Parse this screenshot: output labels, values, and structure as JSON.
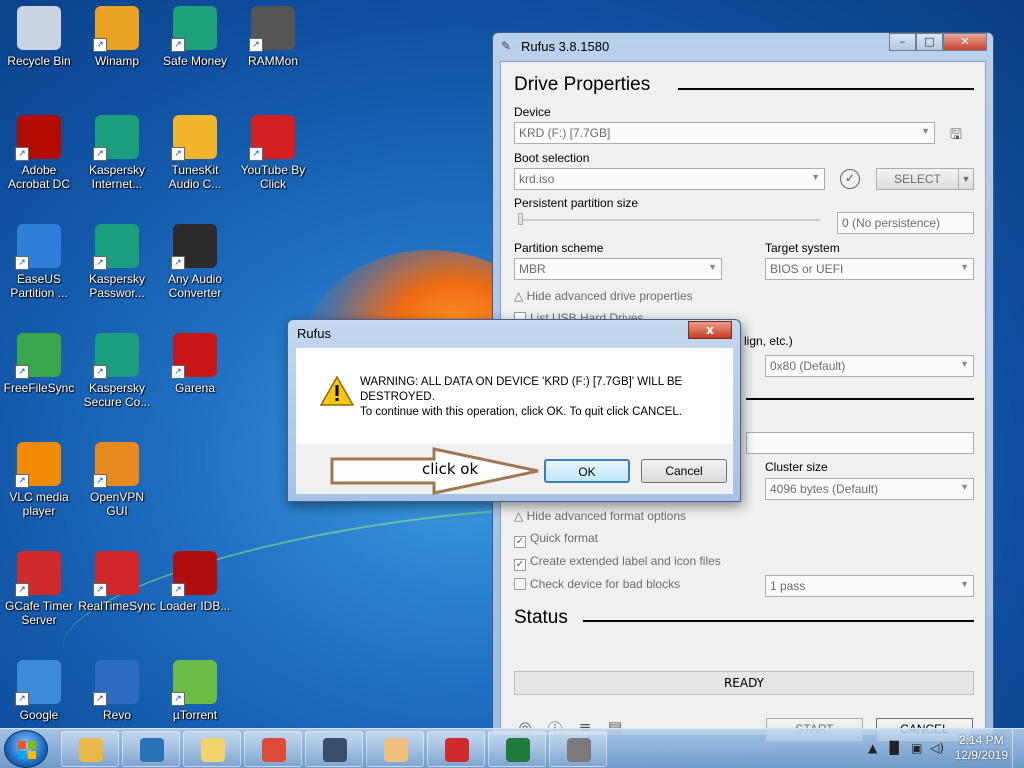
{
  "desktop": {
    "icons": [
      {
        "label": "Recycle Bin",
        "icon": "recycle-bin-icon",
        "color": "#c9d4e0"
      },
      {
        "label": "Winamp",
        "icon": "winamp-icon",
        "color": "#e9a321"
      },
      {
        "label": "Safe Money",
        "icon": "safe-money-icon",
        "color": "#1ba27a"
      },
      {
        "label": "RAMMon",
        "icon": "rammon-icon",
        "color": "#555555"
      },
      {
        "label": "Adobe Acrobat DC",
        "icon": "acrobat-icon",
        "color": "#b30b00"
      },
      {
        "label": "Kaspersky Internet...",
        "icon": "kaspersky-icon",
        "color": "#1a9e7e"
      },
      {
        "label": "TunesKit Audio C...",
        "icon": "tuneskit-icon",
        "color": "#f2b52c"
      },
      {
        "label": "YouTube By Click",
        "icon": "youtube-icon",
        "color": "#d32020"
      },
      {
        "label": "EaseUS Partition ...",
        "icon": "easeus-icon",
        "color": "#2f7fd8"
      },
      {
        "label": "Kaspersky Passwor...",
        "icon": "kaspersky-password-icon",
        "color": "#1a9e7e"
      },
      {
        "label": "Any Audio Converter",
        "icon": "any-audio-icon",
        "color": "#2b2b2b"
      },
      {
        "label": "FreeFileSync",
        "icon": "freefilesync-icon",
        "color": "#3aa64b"
      },
      {
        "label": "Kaspersky Secure Co...",
        "icon": "kaspersky-secure-icon",
        "color": "#1a9e7e"
      },
      {
        "label": "Garena",
        "icon": "garena-icon",
        "color": "#c81515"
      },
      {
        "label": "VLC media player",
        "icon": "vlc-icon",
        "color": "#f08a00"
      },
      {
        "label": "OpenVPN GUI",
        "icon": "openvpn-icon",
        "color": "#e98a1f"
      },
      {
        "label": "GCafe Timer Server",
        "icon": "gcafe-icon",
        "color": "#d12a2a"
      },
      {
        "label": "RealTimeSync",
        "icon": "realtimesync-icon",
        "color": "#d3262b"
      },
      {
        "label": "Loader IDB...",
        "icon": "loader-icon",
        "color": "#b10f0f"
      },
      {
        "label": "Google",
        "icon": "chrome-icon",
        "color": "#3b8bd9"
      },
      {
        "label": "Revo",
        "icon": "revo-icon",
        "color": "#2d6bc4"
      },
      {
        "label": "µTorrent",
        "icon": "utorrent-icon",
        "color": "#6cbd45"
      }
    ]
  },
  "rufus": {
    "title": "Rufus 3.8.1580",
    "drive_properties_heading": "Drive Properties",
    "device_label": "Device",
    "device_value": "KRD (F:) [7.7GB]",
    "boot_selection_label": "Boot selection",
    "boot_selection_value": "krd.iso",
    "select_button": "SELECT",
    "persistent_label": "Persistent partition size",
    "persistent_value": "0 (No persistence)",
    "partition_scheme_label": "Partition scheme",
    "partition_scheme_value": "MBR",
    "target_system_label": "Target system",
    "target_system_value": "BIOS or UEFI",
    "hide_advanced_drive": "Hide advanced drive properties",
    "list_usb": "List USB Hard Drives",
    "align_partial": "lign, etc.)",
    "bios_id_value": "0x80 (Default)",
    "cluster_size_label": "Cluster size",
    "cluster_size_value": "4096 bytes (Default)",
    "hide_advanced_format": "Hide advanced format options",
    "quick_format": "Quick format",
    "extended_label": "Create extended label and icon files",
    "bad_blocks": "Check device for bad blocks",
    "passes_value": "1 pass",
    "status_heading": "Status",
    "status_text": "READY",
    "start_button": "START",
    "cancel_button": "CANCEL"
  },
  "dialog": {
    "title": "Rufus",
    "message_line1": "WARNING: ALL DATA ON DEVICE 'KRD (F:) [7.7GB]' WILL BE DESTROYED.",
    "message_line2": "To continue with this operation, click OK. To quit click CANCEL.",
    "ok_button": "OK",
    "cancel_button": "Cancel",
    "close_symbol": "x"
  },
  "annotation": {
    "text": "click ok",
    "color": "#a07850"
  },
  "taskbar": {
    "apps": [
      {
        "icon": "file-explorer-icon",
        "color": "#e8b84a"
      },
      {
        "icon": "vmware-icon",
        "color": "#2a72b8"
      },
      {
        "icon": "folder-icon",
        "color": "#f2d36b"
      },
      {
        "icon": "chrome-icon",
        "color": "#dd4b39"
      },
      {
        "icon": "media-player-icon",
        "color": "#3a4d6b"
      },
      {
        "icon": "character-app-icon",
        "color": "#f0c080"
      },
      {
        "icon": "gcafe-icon",
        "color": "#d12a2a"
      },
      {
        "icon": "excel-icon",
        "color": "#1f7a3d"
      },
      {
        "icon": "usb-drive-icon",
        "color": "#7a7a7a"
      }
    ],
    "time": "2:14 PM",
    "date": "12/9/2019"
  }
}
